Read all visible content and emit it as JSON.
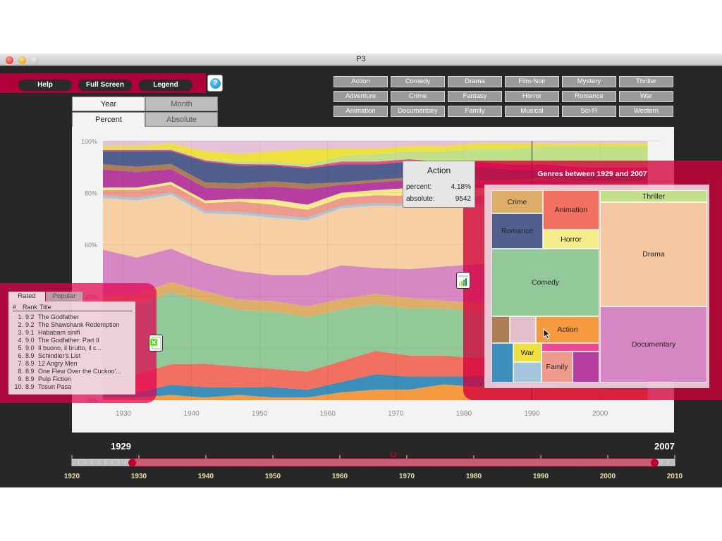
{
  "window": {
    "title": "P3"
  },
  "toolbar": {
    "help_label": "Help",
    "fullscreen_label": "Full Screen",
    "legend_label": "Legend",
    "info_icon": "help-icon"
  },
  "view_tabs": {
    "granularity": [
      {
        "label": "Year",
        "active": true
      },
      {
        "label": "Month",
        "active": false
      }
    ],
    "scale": [
      {
        "label": "Percent",
        "active": true
      },
      {
        "label": "Absolute",
        "active": false
      }
    ]
  },
  "genre_buttons": [
    [
      "Action",
      "Comedy",
      "Drama",
      "Film-Noir",
      "Mystery",
      "Thriller"
    ],
    [
      "Adventure",
      "Crime",
      "Fantasy",
      "Horror",
      "Romance",
      "War"
    ],
    [
      "Animation",
      "Documentary",
      "Family",
      "Musical",
      "Sci-Fi",
      "Western"
    ]
  ],
  "tooltip": {
    "title": "Action",
    "percent_label": "percent:",
    "percent_value": "4.18%",
    "absolute_label": "absolute:",
    "absolute_value": "9542"
  },
  "top_list": {
    "tabs": [
      {
        "label": "Rated",
        "active": true
      },
      {
        "label": "Popular",
        "active": false
      }
    ],
    "headers": {
      "num": "#",
      "rank": "Rank",
      "title": "Title"
    },
    "rows": [
      {
        "num": "1.",
        "rank": "9.2",
        "title": "The Godfather"
      },
      {
        "num": "2.",
        "rank": "9.2",
        "title": "The Shawshank Redemption"
      },
      {
        "num": "3.",
        "rank": "9.1",
        "title": "Hababam sinifi"
      },
      {
        "num": "4.",
        "rank": "9.0",
        "title": "The Godfather: Part II"
      },
      {
        "num": "5.",
        "rank": "9.0",
        "title": "Il buono, il brutto, il c..."
      },
      {
        "num": "6.",
        "rank": "8.9",
        "title": "Schindler's List"
      },
      {
        "num": "7.",
        "rank": "8.9",
        "title": "12 Angry Men"
      },
      {
        "num": "8.",
        "rank": "8.9",
        "title": "One Flew Over the Cuckoo'..."
      },
      {
        "num": "9.",
        "rank": "8.9",
        "title": "Pulp Fiction"
      },
      {
        "num": "10.",
        "rank": "8.9",
        "title": "Tosun Pasa"
      }
    ]
  },
  "treemap": {
    "title": "Genres between 1929 and 2007",
    "cells": [
      {
        "label": "Crime",
        "color": "#dfae68"
      },
      {
        "label": "Romance",
        "color": "#515f8f"
      },
      {
        "label": "Animation",
        "color": "#f1705f"
      },
      {
        "label": "Horror",
        "color": "#f4ec88"
      },
      {
        "label": "Thriller",
        "color": "#c2e08a"
      },
      {
        "label": "Drama",
        "color": "#f5c7a3"
      },
      {
        "label": "Comedy",
        "color": "#93c999"
      },
      {
        "label": "Documentary",
        "color": "#d788c4"
      },
      {
        "label": "",
        "color": "#ad7d56"
      },
      {
        "label": "",
        "color": "#e3bfcc"
      },
      {
        "label": "Action",
        "color": "#f59a40"
      },
      {
        "label": "",
        "color": "#3d8fbb"
      },
      {
        "label": "War",
        "color": "#ede03f"
      },
      {
        "label": "",
        "color": "#a4c6db"
      },
      {
        "label": "",
        "color": "#ed4a93"
      },
      {
        "label": "Family",
        "color": "#ee9a8c"
      },
      {
        "label": "",
        "color": "#b73ea1"
      }
    ]
  },
  "timeline": {
    "start_year": "1929",
    "end_year": "2007",
    "min": 1920,
    "max": 2010,
    "range": [
      1929,
      2007
    ],
    "marker": 1968,
    "tick_labels": [
      "1920",
      "1930",
      "1940",
      "1950",
      "1960",
      "1970",
      "1980",
      "1990",
      "2000",
      "2010"
    ]
  },
  "icons": {
    "export_excel": "excel-export-icon",
    "chart_icon": "bar-chart-icon"
  },
  "chart_data": {
    "type": "area",
    "stacked": "percent",
    "title": "",
    "xlabel": "",
    "ylabel": "",
    "xlim": [
      1927,
      2009
    ],
    "ylim": [
      0,
      100
    ],
    "y_tick_labels": [
      "0%",
      "20%",
      "40%",
      "60%",
      "80%",
      "100%"
    ],
    "x_tick_labels": [
      "1930",
      "1940",
      "1950",
      "1960",
      "1970",
      "1980",
      "1990",
      "2000"
    ],
    "hover_year": 1990,
    "x": [
      1927,
      1932,
      1937,
      1942,
      1947,
      1952,
      1957,
      1962,
      1967,
      1972,
      1977,
      1982,
      1987,
      1992,
      1997,
      2002,
      2007
    ],
    "series": [
      {
        "name": "Action",
        "color": "#f59a40",
        "values": [
          1,
          1,
          2,
          1,
          2,
          1,
          1,
          3,
          4,
          4,
          6,
          5,
          6,
          6,
          5,
          4,
          4
        ]
      },
      {
        "name": "Adventure",
        "color": "#3d8fbb",
        "values": [
          2,
          2,
          4,
          4,
          3,
          4,
          3,
          4,
          6,
          5,
          3,
          4,
          3,
          3,
          3,
          2,
          2
        ]
      },
      {
        "name": "Animation",
        "color": "#f1705f",
        "values": [
          5,
          7,
          8,
          9,
          8,
          7,
          7,
          8,
          9,
          8,
          8,
          7,
          7,
          6,
          5,
          5,
          5
        ]
      },
      {
        "name": "Comedy",
        "color": "#93c999",
        "values": [
          28,
          27,
          28,
          24,
          22,
          22,
          21,
          20,
          18,
          18,
          18,
          18,
          17,
          17,
          15,
          14,
          13
        ]
      },
      {
        "name": "Crime",
        "color": "#dfae68",
        "values": [
          4,
          4,
          4,
          4,
          4,
          4,
          4,
          4,
          4,
          4,
          3,
          3,
          3,
          3,
          2,
          2,
          2
        ]
      },
      {
        "name": "Documentary",
        "color": "#d788c4",
        "values": [
          18,
          14,
          13,
          11,
          11,
          10,
          12,
          13,
          10,
          11,
          13,
          15,
          17,
          19,
          21,
          23,
          25
        ]
      },
      {
        "name": "Drama",
        "color": "#f6cfa5",
        "values": [
          20,
          22,
          21,
          19,
          22,
          22,
          21,
          22,
          24,
          24,
          23,
          22,
          22,
          22,
          24,
          25,
          25
        ]
      },
      {
        "name": "Family",
        "color": "#a4c6db",
        "values": [
          1,
          1,
          1,
          1,
          1,
          1,
          1,
          1,
          1,
          1,
          1,
          1,
          1,
          1,
          1,
          1,
          1
        ]
      },
      {
        "name": "Fantasy",
        "color": "#ee9a8c",
        "values": [
          2,
          3,
          3,
          3,
          4,
          4,
          3,
          3,
          3,
          3,
          3,
          3,
          3,
          3,
          2,
          2,
          2
        ]
      },
      {
        "name": "Horror",
        "color": "#f4ec88",
        "values": [
          1,
          1,
          1,
          1,
          1,
          2,
          2,
          2,
          2,
          3,
          3,
          3,
          2,
          2,
          2,
          1,
          1
        ]
      },
      {
        "name": "Musical",
        "color": "#b73ea1",
        "values": [
          7,
          6,
          5,
          5,
          4,
          5,
          6,
          3,
          3,
          3,
          3,
          2,
          2,
          2,
          2,
          2,
          2
        ]
      },
      {
        "name": "Mystery",
        "color": "#ad7d56",
        "values": [
          2,
          2,
          2,
          2,
          2,
          2,
          2,
          1,
          1,
          1,
          1,
          1,
          1,
          1,
          1,
          1,
          1
        ]
      },
      {
        "name": "Romance",
        "color": "#515f8f",
        "values": [
          5,
          6,
          5,
          8,
          7,
          6,
          6,
          7,
          6,
          6,
          5,
          5,
          4,
          3,
          3,
          3,
          3
        ]
      },
      {
        "name": "Sci-Fi",
        "color": "#ed4a93",
        "values": [
          0.5,
          0.5,
          0.5,
          0.5,
          0.5,
          0.5,
          0.5,
          1,
          1,
          1,
          1,
          2,
          2,
          2,
          2,
          2,
          2
        ]
      },
      {
        "name": "Thriller",
        "color": "#c2e08a",
        "values": [
          0.5,
          0.5,
          0.5,
          0.5,
          1,
          1,
          1,
          2,
          3,
          3,
          4,
          5,
          6,
          7,
          8,
          8,
          8
        ]
      },
      {
        "name": "War",
        "color": "#ede03f",
        "values": [
          1,
          1,
          2,
          3,
          3,
          4,
          6,
          3,
          2,
          2,
          2,
          2,
          2,
          1,
          1,
          1,
          1
        ]
      },
      {
        "name": "Western",
        "color": "#e3c3d5",
        "values": [
          2,
          2,
          1,
          4,
          5,
          4,
          3,
          3,
          3,
          2,
          2,
          1,
          1,
          1,
          1,
          1,
          1
        ]
      }
    ]
  }
}
